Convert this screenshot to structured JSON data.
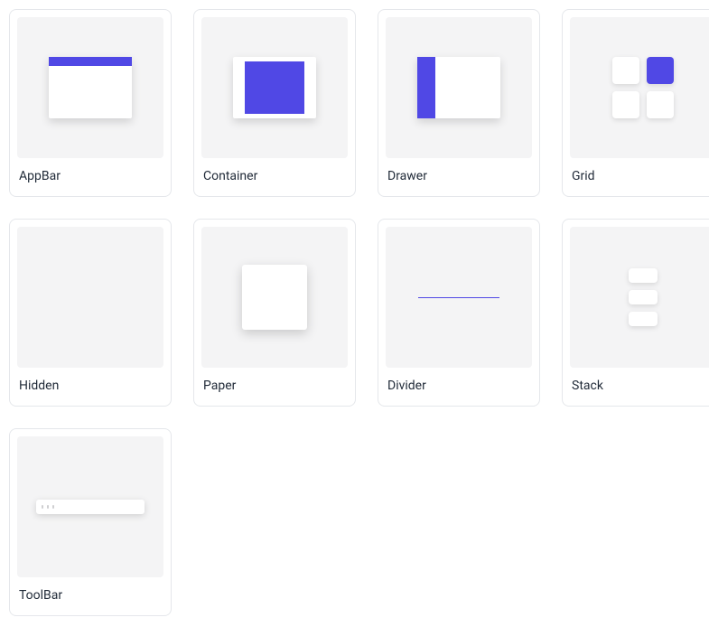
{
  "colors": {
    "accent": "#5048e5",
    "card_border": "#e5e7eb",
    "preview_bg": "#f4f4f5"
  },
  "components": [
    {
      "id": "appbar",
      "label": "AppBar"
    },
    {
      "id": "container",
      "label": "Container"
    },
    {
      "id": "drawer",
      "label": "Drawer"
    },
    {
      "id": "grid",
      "label": "Grid"
    },
    {
      "id": "hidden",
      "label": "Hidden"
    },
    {
      "id": "paper",
      "label": "Paper"
    },
    {
      "id": "divider",
      "label": "Divider"
    },
    {
      "id": "stack",
      "label": "Stack"
    },
    {
      "id": "toolbar",
      "label": "ToolBar"
    }
  ]
}
